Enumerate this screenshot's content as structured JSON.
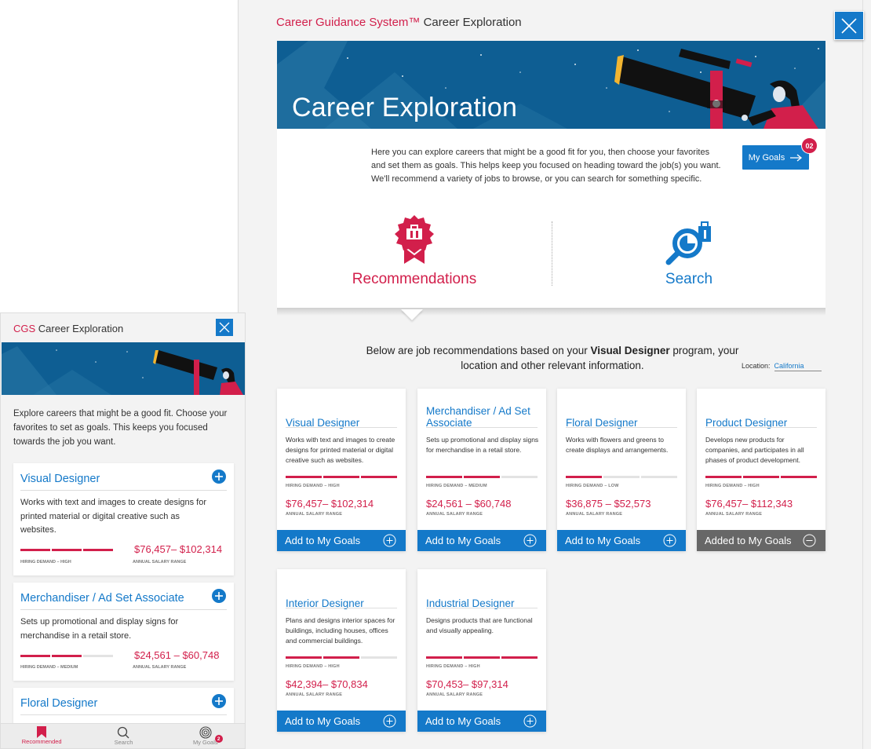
{
  "desktop": {
    "title_brand": "Career Guidance System™",
    "title_rest": "Career Exploration",
    "hero_title": "Career Exploration",
    "intro_text": "Here you can explore careers that might be a good fit for you, then choose your favorites and set them as goals. This helps keep you focused on heading toward the job(s) you want. We'll recommend a variety of jobs to browse, or you can search for something specific.",
    "my_goals_label": "My Goals",
    "my_goals_count": "02",
    "mode_recommendations": "Recommendations",
    "mode_search": "Search",
    "rec_desc_before": "Below are job recommendations based on your ",
    "rec_desc_program": "Visual Designer",
    "rec_desc_after": " program, your location and other relevant information.",
    "location_label": "Location:",
    "location_value": "California",
    "salary_label": "ANNUAL SALARY RANGE",
    "cards": [
      {
        "title": "Visual Designer",
        "desc": "Works with text and images to create designs for printed material or digital creative such as websites.",
        "demand": "HIRING DEMAND – HIGH",
        "demand_level": 3,
        "salary": "$76,457– $102,314",
        "button": "Add to My Goals",
        "added": false
      },
      {
        "title": "Merchandiser / Ad Set Associate",
        "desc": "Sets up promotional and display signs for merchandise in a retail store.",
        "demand": "HIRING DEMAND – MEDIUM",
        "demand_level": 2,
        "salary": "$24,561 – $60,748",
        "button": "Add to My Goals",
        "added": false
      },
      {
        "title": "Floral Designer",
        "desc": "Works with flowers and greens to create displays and arrangements.",
        "demand": "HIRING DEMAND – LOW",
        "demand_level": 1,
        "salary": "$36,875 – $52,573",
        "button": "Add to My Goals",
        "added": false
      },
      {
        "title": "Product Designer",
        "desc": "Develops new products for companies, and participates in all phases of product development.",
        "demand": "HIRING DEMAND – HIGH",
        "demand_level": 3,
        "salary": "$76,457– $112,343",
        "button": "Added to My Goals",
        "added": true
      },
      {
        "title": "Interior Designer",
        "desc": "Plans and designs interior spaces for buildings, including houses, offices and commercial buildings.",
        "demand": "HIRING DEMAND – HIGH",
        "demand_level": 2,
        "salary": "$42,394– $70,834",
        "button": "Add to My Goals",
        "added": false
      },
      {
        "title": "Industrial Designer",
        "desc": "Designs products that are functional and visually appealing.",
        "demand": "HIRING DEMAND – HIGH",
        "demand_level": 3,
        "salary": "$70,453– $97,314",
        "button": "Add to My Goals",
        "added": false
      }
    ]
  },
  "mobile": {
    "title_brand": "CGS",
    "title_rest": "Career Exploration",
    "intro_text": "Explore careers that might be a good fit. Choose your favorites to set as goals. This keeps you focused towards the job you want.",
    "salary_label": "ANNUAL SALARY RANGE",
    "cards": [
      {
        "title": "Visual Designer",
        "desc": "Works with text and images to create designs for printed material or digital creative such as websites.",
        "demand": "HIRING DEMAND – HIGH",
        "demand_level": 3,
        "salary": "$76,457– $102,314"
      },
      {
        "title": "Merchandiser / Ad Set Associate",
        "desc": "Sets up promotional and display signs for merchandise in a retail store.",
        "demand": "HIRING DEMAND – MEDIUM",
        "demand_level": 2,
        "salary": "$24,561 – $60,748"
      },
      {
        "title": "Floral Designer"
      }
    ],
    "nav": [
      {
        "label": "Recommended",
        "icon": "bookmark-icon",
        "active": true
      },
      {
        "label": "Search",
        "icon": "search-icon",
        "active": false
      },
      {
        "label": "My Goals",
        "icon": "target-icon",
        "active": false,
        "badge": "2"
      }
    ]
  },
  "colors": {
    "brand_red": "#d21f4b",
    "brand_blue": "#1479c9",
    "added_gray": "#676767",
    "hero_blue": "#0e5e93"
  }
}
